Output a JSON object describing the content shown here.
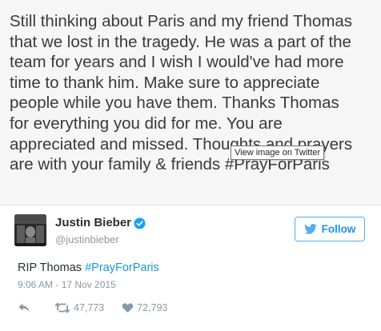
{
  "tweet_image": {
    "text": "Still thinking about Paris and my friend Thomas\nthat we lost in the tragedy. He was a part of the\nteam for years and I wish I would've had more\ntime to thank him. Make sure to appreciate\npeople while you have them. Thanks Thomas\nfor everything you did for me. You are\nappreciated and missed. Thoughts and prayers\nare with your family & friends #PrayForParis",
    "tooltip": "View image on Twitter"
  },
  "author": {
    "name": "Justin Bieber",
    "handle": "@justinbieber",
    "verified": true
  },
  "follow_button": {
    "label": "Follow",
    "icon": "twitter-bird-icon"
  },
  "tweet": {
    "text_prefix": "RIP Thomas ",
    "hashtag": "#PrayForParis",
    "timestamp": "9:06 AM - 17 Nov 2015"
  },
  "actions": {
    "reply_icon": "reply-icon",
    "retweet_icon": "retweet-icon",
    "retweets": "47,773",
    "like_icon": "heart-icon",
    "likes": "72,793"
  },
  "colors": {
    "accent": "#1b95e0",
    "muted": "#8899a6",
    "text": "#292f33"
  }
}
